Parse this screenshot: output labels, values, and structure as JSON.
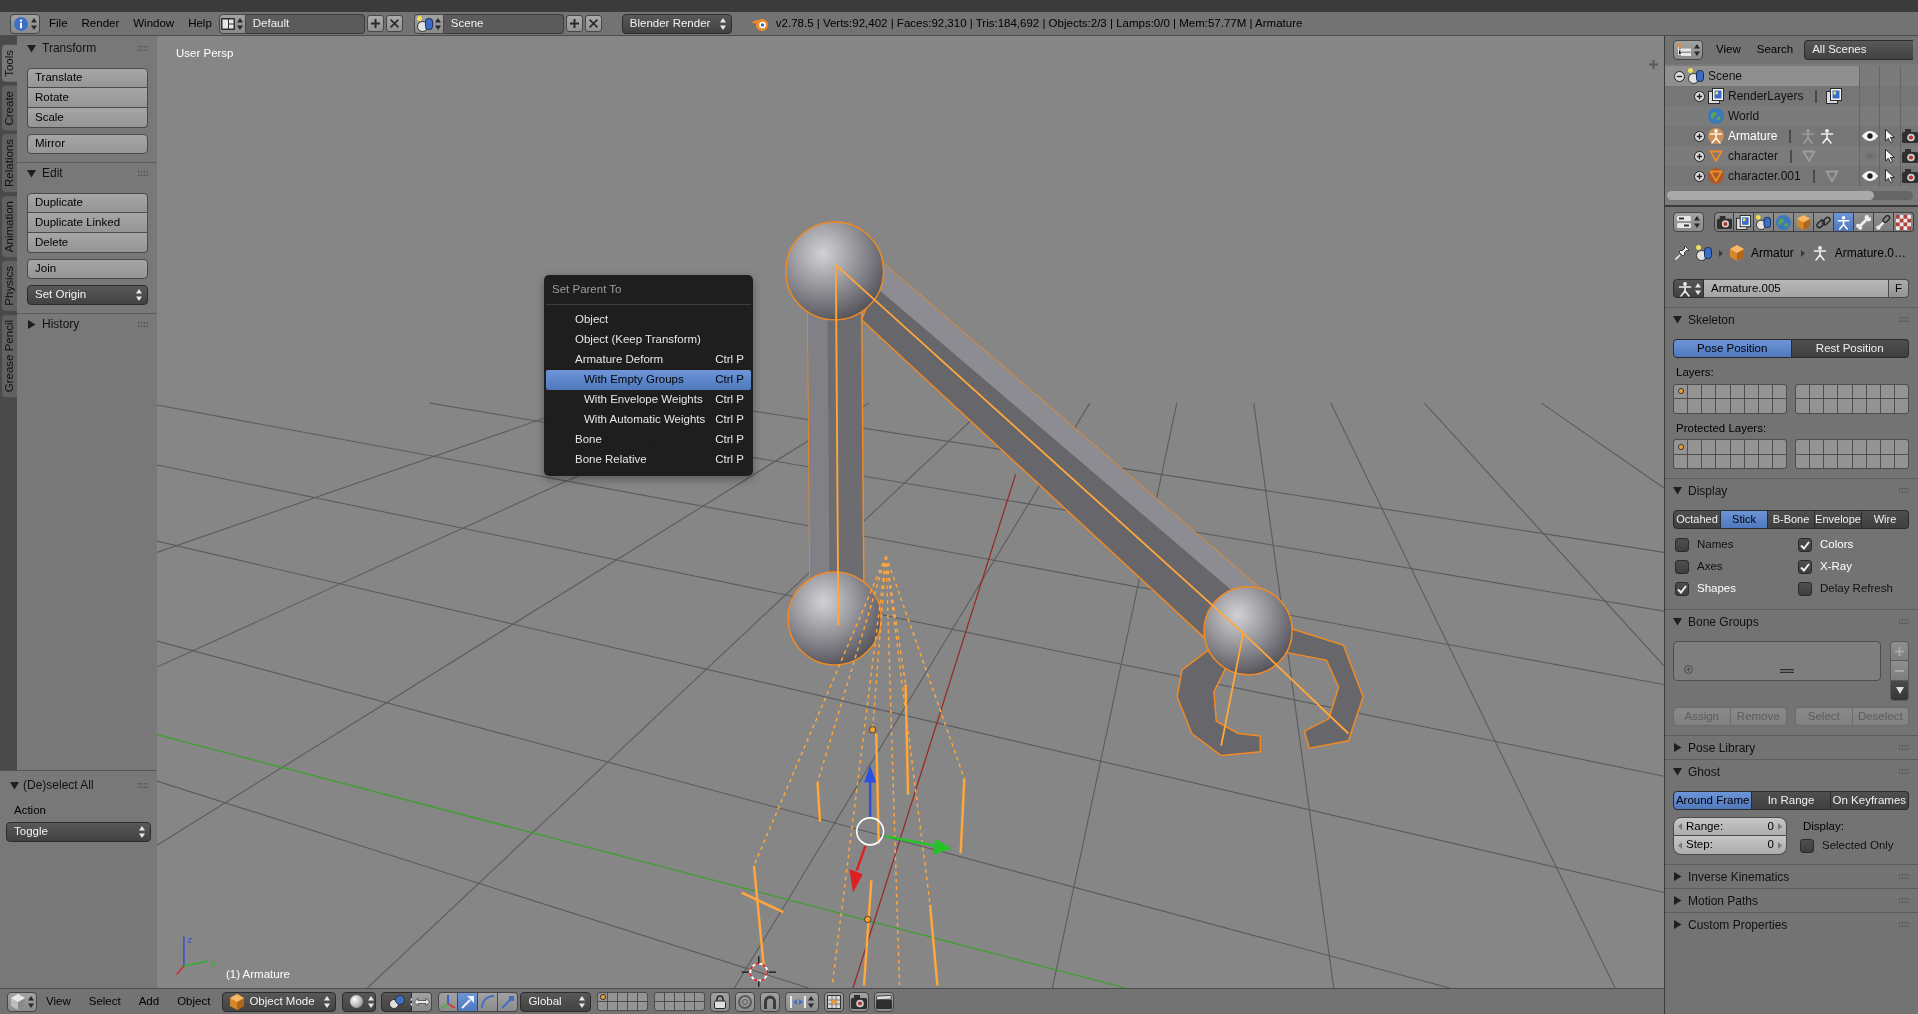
{
  "top_header": {
    "menus": [
      "File",
      "Render",
      "Window",
      "Help"
    ],
    "screen_layout": "Default",
    "scene": "Scene",
    "render_engine": "Blender Render",
    "stats": "v2.78.5 | Verts:92,402 | Faces:92,310 | Tris:184,692 | Objects:2/3 | Lamps:0/0 | Mem:57.77M | Armature"
  },
  "tool_tabs": [
    {
      "label": "Tools",
      "selected": true
    },
    {
      "label": "Create",
      "selected": false
    },
    {
      "label": "Relations",
      "selected": false
    },
    {
      "label": "Animation",
      "selected": false
    },
    {
      "label": "Physics",
      "selected": false
    },
    {
      "label": "Grease Pencil",
      "selected": false
    }
  ],
  "tool_shelf": {
    "panels": [
      {
        "title": "Transform",
        "expanded": true,
        "groups": [
          [
            "Translate",
            "Rotate",
            "Scale"
          ],
          [
            "Mirror"
          ]
        ]
      },
      {
        "title": "Edit",
        "expanded": true,
        "groups": [
          [
            "Duplicate",
            "Duplicate Linked",
            "Delete"
          ],
          [
            "Join"
          ]
        ],
        "dropdown": "Set Origin"
      },
      {
        "title": "History",
        "expanded": false
      }
    ]
  },
  "operator_panel": {
    "title": "(De)select All",
    "expanded": true,
    "label": "Action",
    "value": "Toggle"
  },
  "viewport": {
    "view_name": "User Persp",
    "object_info": "(1) Armature",
    "axis_labels": [
      "z",
      "y"
    ]
  },
  "context_menu": {
    "title": "Set Parent To",
    "items": [
      {
        "label": "Object",
        "selected": false
      },
      {
        "label": "Object (Keep Transform)",
        "selected": false
      },
      {
        "label": "Armature Deform",
        "shortcut": "Ctrl P",
        "selected": false,
        "children": [
          {
            "label": "With Empty Groups",
            "shortcut": "Ctrl P",
            "selected": true
          },
          {
            "label": "With Envelope Weights",
            "shortcut": "Ctrl P",
            "selected": false
          },
          {
            "label": "With Automatic Weights",
            "shortcut": "Ctrl P",
            "selected": false
          }
        ]
      },
      {
        "label": "Bone",
        "shortcut": "Ctrl P",
        "selected": false
      },
      {
        "label": "Bone Relative",
        "shortcut": "Ctrl P",
        "selected": false
      }
    ]
  },
  "view3d_header": {
    "menus": [
      "View",
      "Select",
      "Add",
      "Object"
    ],
    "mode": "Object Mode",
    "manipulators": [
      {
        "kind": "axes",
        "selected": false
      },
      {
        "kind": "translate",
        "selected": true
      },
      {
        "kind": "rotate",
        "selected": false
      },
      {
        "kind": "scale",
        "selected": false
      }
    ],
    "orientation": "Global",
    "layers": {
      "occupied": [
        true,
        false,
        false,
        false,
        false,
        false,
        false,
        false,
        false,
        false,
        false,
        false,
        false,
        false,
        false,
        false,
        false,
        false,
        false,
        false
      ]
    }
  },
  "outliner": {
    "menus": [
      "View",
      "Search"
    ],
    "filter": "All Scenes",
    "tree": [
      {
        "name": "Scene",
        "kind": "scene",
        "expanded": true,
        "highlighted": true,
        "selected": false,
        "children": [
          {
            "name": "RenderLayers",
            "kind": "render_layers",
            "expanded": false,
            "highlighted": false,
            "selected": false
          },
          {
            "name": "World",
            "kind": "world",
            "highlighted": false,
            "selected": false
          },
          {
            "name": "Armature",
            "kind": "armature",
            "expanded": false,
            "highlighted": false,
            "selected": true,
            "active": true,
            "visible": true
          },
          {
            "name": "character",
            "kind": "mesh",
            "expanded": false,
            "highlighted": false,
            "selected": false,
            "active": false,
            "visible": false
          },
          {
            "name": "character.001",
            "kind": "mesh",
            "expanded": false,
            "highlighted": false,
            "selected": true,
            "active": false,
            "visible": true
          }
        ]
      }
    ]
  },
  "properties": {
    "tabs": [
      {
        "kind": "render",
        "selected": false
      },
      {
        "kind": "render_layers",
        "selected": false
      },
      {
        "kind": "scene",
        "selected": false
      },
      {
        "kind": "world",
        "selected": false
      },
      {
        "kind": "object",
        "selected": false
      },
      {
        "kind": "constraints",
        "selected": false
      },
      {
        "kind": "data",
        "selected": true
      },
      {
        "kind": "bone",
        "selected": false
      },
      {
        "kind": "bone_constraints",
        "selected": false
      },
      {
        "kind": "texture",
        "selected": false
      }
    ],
    "breadcrumb": [
      "Armatur",
      "Armature.0…"
    ],
    "datablock": {
      "name": "Armature.005",
      "fake_user": "F"
    },
    "panels": [
      {
        "kind": "skeleton",
        "title": "Skeleton",
        "expanded": true,
        "positions": [
          {
            "label": "Pose Position",
            "selected": true
          },
          {
            "label": "Rest Position",
            "selected": false
          }
        ],
        "layers": {
          "label": "Layers:",
          "occupied": [
            true,
            false,
            false,
            false,
            false,
            false,
            false,
            false,
            false,
            false,
            false,
            false,
            false,
            false,
            false,
            false,
            false,
            false,
            false,
            false,
            false,
            false,
            false,
            false,
            false,
            false,
            false,
            false,
            false,
            false,
            false,
            false
          ]
        },
        "protected_layers": {
          "label": "Protected Layers:",
          "occupied": [
            true,
            false,
            false,
            false,
            false,
            false,
            false,
            false,
            false,
            false,
            false,
            false,
            false,
            false,
            false,
            false,
            false,
            false,
            false,
            false,
            false,
            false,
            false,
            false,
            false,
            false,
            false,
            false,
            false,
            false,
            false,
            false
          ]
        }
      },
      {
        "kind": "display",
        "title": "Display",
        "expanded": true,
        "modes": [
          {
            "label": "Octahed",
            "selected": false
          },
          {
            "label": "Stick",
            "selected": true
          },
          {
            "label": "B-Bone",
            "selected": false
          },
          {
            "label": "Envelope",
            "selected": false
          },
          {
            "label": "Wire",
            "selected": false
          }
        ],
        "options": [
          {
            "label": "Names",
            "checked": false
          },
          {
            "label": "Colors",
            "checked": true
          },
          {
            "label": "Axes",
            "checked": false
          },
          {
            "label": "X-Ray",
            "checked": true
          },
          {
            "label": "Shapes",
            "checked": true
          },
          {
            "label": "Delay Refresh",
            "checked": false
          }
        ]
      },
      {
        "kind": "bone_groups",
        "title": "Bone Groups",
        "expanded": true,
        "buttons": [
          {
            "label": "Assign",
            "disabled": true
          },
          {
            "label": "Remove",
            "disabled": true
          },
          {
            "label": "Select",
            "disabled": true
          },
          {
            "label": "Deselect",
            "disabled": true
          }
        ]
      },
      {
        "title": "Pose Library",
        "expanded": false
      },
      {
        "kind": "ghost",
        "title": "Ghost",
        "expanded": true,
        "modes": [
          {
            "label": "Around Frame",
            "selected": true
          },
          {
            "label": "In Range",
            "selected": false
          },
          {
            "label": "On Keyframes",
            "selected": false
          }
        ],
        "fields": [
          {
            "label": "Range:",
            "value": "0"
          },
          {
            "label": "Step:",
            "value": "0"
          }
        ],
        "display_label": "Display:",
        "option": {
          "label": "Selected Only",
          "checked": false
        }
      },
      {
        "title": "Inverse Kinematics",
        "expanded": false
      },
      {
        "title": "Motion Paths",
        "expanded": false
      },
      {
        "title": "Custom Properties",
        "expanded": false
      }
    ]
  }
}
